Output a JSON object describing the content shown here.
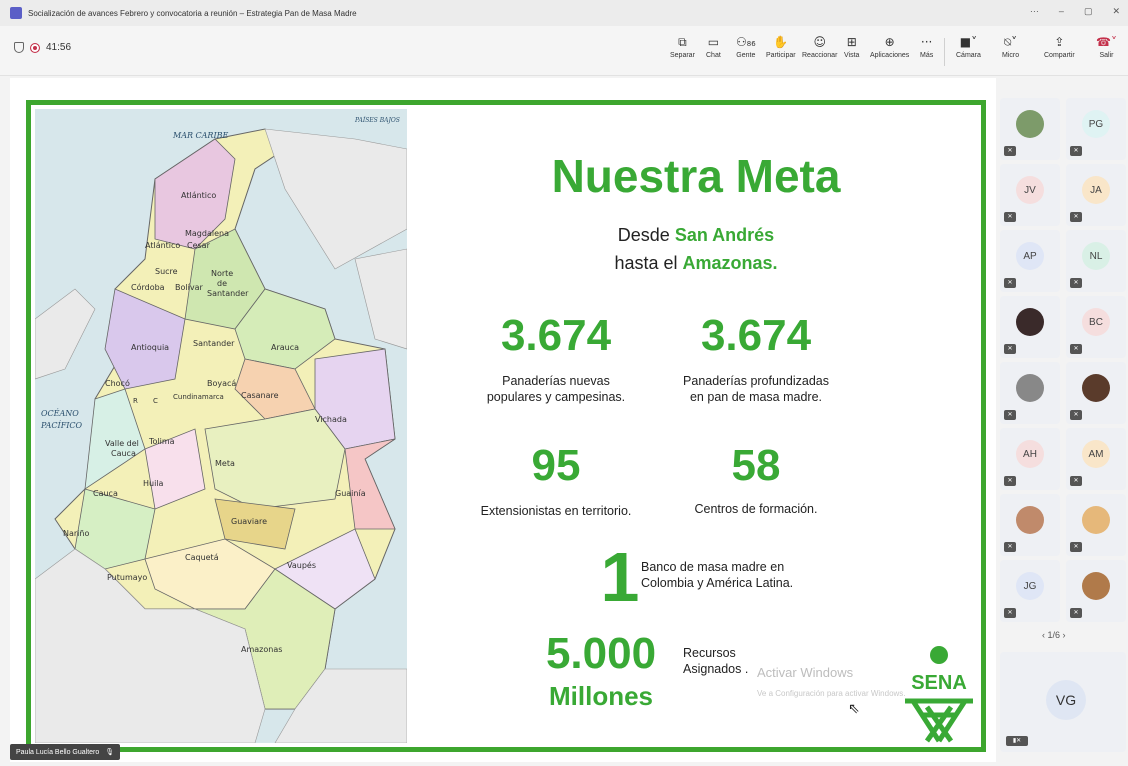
{
  "window": {
    "title": "Socialización de avances Febrero y convocatoria a reunión – Estrategia Pan de Masa Madre"
  },
  "recording": {
    "time": "41:56"
  },
  "toolbar": {
    "people_count": "86",
    "buttons": [
      {
        "label": "Separar",
        "icon": "separate-icon"
      },
      {
        "label": "Chat",
        "icon": "chat-icon"
      },
      {
        "label": "Gente",
        "icon": "people-icon"
      },
      {
        "label": "Participar",
        "icon": "raise-hand-icon"
      },
      {
        "label": "Reaccionar",
        "icon": "react-icon"
      },
      {
        "label": "Vista",
        "icon": "view-icon"
      },
      {
        "label": "Aplicaciones",
        "icon": "apps-icon"
      },
      {
        "label": "Más",
        "icon": "more-icon"
      },
      {
        "label": "Cámara",
        "icon": "camera-icon"
      },
      {
        "label": "Micro",
        "icon": "mic-icon"
      },
      {
        "label": "Compartir",
        "icon": "share-icon"
      },
      {
        "label": "Salir",
        "icon": "leave-icon"
      }
    ]
  },
  "slide": {
    "title": "Nuestra Meta",
    "subtitle_pre1": "Desde ",
    "subtitle_bold1": "San Andrés",
    "subtitle_pre2": "hasta el ",
    "subtitle_bold2": "Amazonas.",
    "stats": [
      {
        "value": "3.674",
        "caption1": "Panaderías nuevas",
        "caption2": "populares y campesinas."
      },
      {
        "value": "3.674",
        "caption1": "Panaderías profundizadas",
        "caption2": "en pan de masa madre."
      },
      {
        "value": "95",
        "caption1": "Extensionistas en territorio.",
        "caption2": ""
      },
      {
        "value": "58",
        "caption1": "Centros de formación.",
        "caption2": ""
      }
    ],
    "bank": {
      "value": "1",
      "caption1": "Banco de masa madre en",
      "caption2": "Colombia y América Latina."
    },
    "money": {
      "value": "5.000",
      "unit": "Millones",
      "caption1": "Recursos",
      "caption2": "Asignados ."
    },
    "logo_text": "SENA",
    "map": {
      "seas": [
        "MAR CARIBE",
        "PAÍSES BAJOS",
        "OCÉANO",
        "PACÍFICO"
      ],
      "departments": [
        "Atlántico",
        "Magdalena",
        "Atlántico",
        "Cesar",
        "Sucre",
        "Norte",
        "de",
        "Santander",
        "Córdoba",
        "Bolívar",
        "Antioquia",
        "Santander",
        "Arauca",
        "Chocó",
        "Boyacá",
        "Casanare",
        "Cundinamarca",
        "Vichada",
        "Valle del",
        "Cauca",
        "Tolima",
        "Meta",
        "Huila",
        "Guainía",
        "Cauca",
        "Guaviare",
        "Nariño",
        "Caquetá",
        "Vaupés",
        "Putumayo",
        "Amazonas",
        "R",
        "C"
      ]
    }
  },
  "watermark": {
    "line1": "Activar Windows",
    "line2": "Ve a Configuración para activar Windows."
  },
  "speaker": {
    "name": "Paula Lucía Bello Gualtero"
  },
  "participants": [
    {
      "initials": "",
      "bg": "#7d9b6a"
    },
    {
      "initials": "PG",
      "bg": "#dff3f3"
    },
    {
      "initials": "JV",
      "bg": "#f5dede"
    },
    {
      "initials": "JA",
      "bg": "#f9e6c9"
    },
    {
      "initials": "AP",
      "bg": "#dfe6f6"
    },
    {
      "initials": "NL",
      "bg": "#d9f0e6"
    },
    {
      "initials": "",
      "bg": "#3a2a2a"
    },
    {
      "initials": "BC",
      "bg": "#f5dede"
    },
    {
      "initials": "",
      "bg": "#888888"
    },
    {
      "initials": "",
      "bg": "#5a3b2b"
    },
    {
      "initials": "AH",
      "bg": "#f5dede"
    },
    {
      "initials": "AM",
      "bg": "#f9e6c9"
    },
    {
      "initials": "",
      "bg": "#c08a6b"
    },
    {
      "initials": "",
      "bg": "#e6b87a"
    },
    {
      "initials": "JG",
      "bg": "#dfe6f6"
    },
    {
      "initials": "",
      "bg": "#b07a4a"
    }
  ],
  "pager": {
    "text": "1/6"
  },
  "self_tile": {
    "initials": "VG"
  }
}
